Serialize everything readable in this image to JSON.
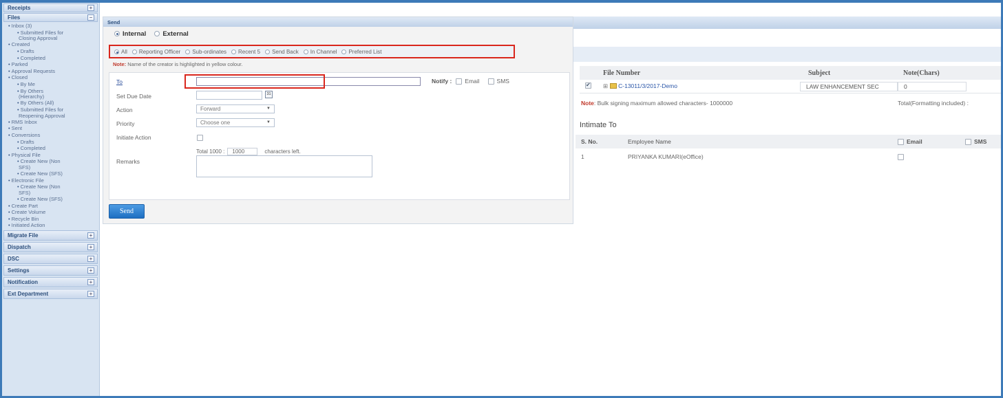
{
  "sidebar": {
    "sections_top": [
      {
        "label": "Receipts",
        "toggle": "+"
      },
      {
        "label": "Files",
        "toggle": "−"
      }
    ],
    "items": [
      {
        "label": "Inbox (3)",
        "level": 1
      },
      {
        "label": "Submitted Files for",
        "level": 2
      },
      {
        "label": "Closing Approval",
        "level": 3
      },
      {
        "label": "Created",
        "level": 1
      },
      {
        "label": "Drafts",
        "level": 2
      },
      {
        "label": "Completed",
        "level": 2
      },
      {
        "label": "Parked",
        "level": 1
      },
      {
        "label": "Approval Requests",
        "level": 1
      },
      {
        "label": "Closed",
        "level": 1
      },
      {
        "label": "By Me",
        "level": 2
      },
      {
        "label": "By Others",
        "level": 2
      },
      {
        "label": "(Hierarchy)",
        "level": 3
      },
      {
        "label": "By Others (All)",
        "level": 2
      },
      {
        "label": "Submitted Files for",
        "level": 2
      },
      {
        "label": "Reopening Approval",
        "level": 3
      },
      {
        "label": "RMS Inbox",
        "level": 1
      },
      {
        "label": "Sent",
        "level": 1
      },
      {
        "label": "Conversions",
        "level": 1
      },
      {
        "label": "Drafts",
        "level": 2
      },
      {
        "label": "Completed",
        "level": 2
      },
      {
        "label": "Physical File",
        "level": 1
      },
      {
        "label": "Create New (Non",
        "level": 2
      },
      {
        "label": "SFS)",
        "level": 3
      },
      {
        "label": "Create New (SFS)",
        "level": 2
      },
      {
        "label": "Electronic File",
        "level": 1
      },
      {
        "label": "Create New (Non",
        "level": 2
      },
      {
        "label": "SFS)",
        "level": 3
      },
      {
        "label": "Create New (SFS)",
        "level": 2
      },
      {
        "label": "Create Part",
        "level": 1
      },
      {
        "label": "Create Volume",
        "level": 1
      },
      {
        "label": "Recycle Bin",
        "level": 1
      },
      {
        "label": "Initiated Action",
        "level": 1
      }
    ],
    "sections_bottom": [
      {
        "label": "Migrate File",
        "toggle": "+"
      },
      {
        "label": "Dispatch",
        "toggle": "+"
      },
      {
        "label": "DSC",
        "toggle": "+"
      },
      {
        "label": "Settings",
        "toggle": "+"
      },
      {
        "label": "Notification",
        "toggle": "+"
      },
      {
        "label": "Ext Department",
        "toggle": "+"
      }
    ]
  },
  "send_panel": {
    "title": "Send",
    "internal_label": "Internal",
    "external_label": "External",
    "filters": [
      "All",
      "Reporting Officer",
      "Sub-ordinates",
      "Recent 5",
      "Send Back",
      "In Channel",
      "Preferred List"
    ],
    "note_label": "Note:",
    "note_text": "Name of the creator is highlighted in yellow colour.",
    "to_label": "To",
    "to_value": "",
    "notify_label": "Notify :",
    "notify_email": "Email",
    "notify_sms": "SMS",
    "due_date_label": "Set Due Date",
    "cal_icon_text": "31",
    "action_label": "Action",
    "action_value": "Forward",
    "priority_label": "Priority",
    "priority_value": "Choose one",
    "initiate_label": "Initiate Action",
    "remarks_label": "Remarks",
    "total_label": "Total 1000 :",
    "chars_left_value": "1000",
    "chars_left_label": "characters left.",
    "send_button": "Send"
  },
  "file_table": {
    "headers": [
      "File Number",
      "Subject",
      "Note(Chars)"
    ],
    "row": {
      "file_number": "C-13011/3/2017-Demo",
      "subject": "LAW ENHANCEMENT SEC",
      "note_chars": "0"
    }
  },
  "bulk_note_label": "Note",
  "bulk_note_text": ": Bulk signing maximum allowed characters- 1000000",
  "total_note": "Total(Formatting included) :",
  "intimate": {
    "title": "Intimate To",
    "headers": {
      "sno": "S. No.",
      "name": "Employee Name",
      "email": "Email",
      "sms": "SMS"
    },
    "row": {
      "sno": "1",
      "name": "PRIYANKA KUMARI(eOffice)"
    }
  },
  "colors": {
    "highlight_border": "#d9261c",
    "send_button": "#1e6fc2",
    "frame": "#3d7ab8"
  }
}
